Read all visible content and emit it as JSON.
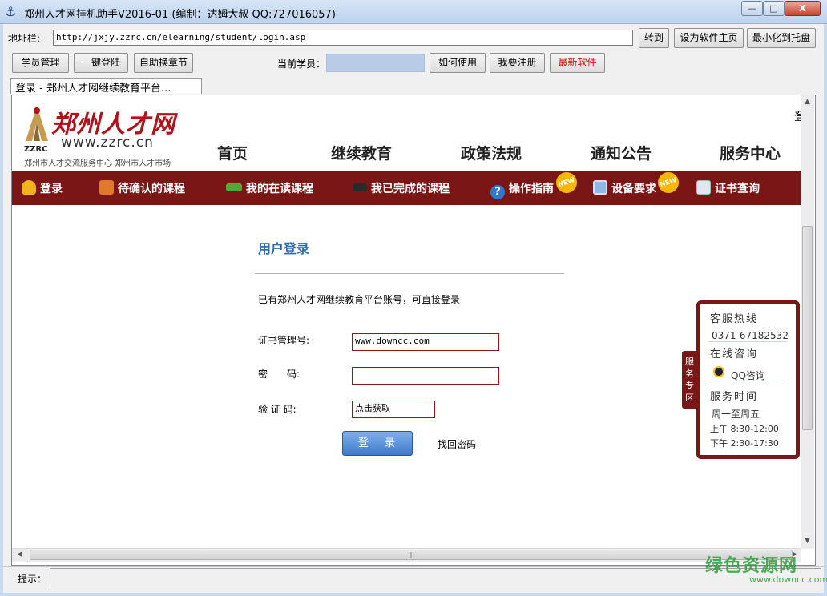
{
  "window": {
    "title": "郑州人才网挂机助手V2016-01 (编制：达姆大叔 QQ:727016057)",
    "min": "—",
    "max": "□",
    "close": "X"
  },
  "toolbar": {
    "address_label": "地址栏:",
    "address_value": "http://jxjy.zzrc.cn/elearning/student/login.asp",
    "go": "转到",
    "set_home": "设为软件主页",
    "to_tray": "最小化到托盘",
    "student_mgmt": "学员管理",
    "one_click_login": "一键登陆",
    "auto_chapter": "自助换章节",
    "current_student_label": "当前学员：",
    "current_student_value": "",
    "how_to_use": "如何使用",
    "register": "我要注册",
    "newest_software": "最新软件"
  },
  "tab": {
    "label": "登录 - 郑州人才网继续教育平台..."
  },
  "site": {
    "logo_cn": "郑州人才网",
    "logo_url": "www.zzrc.cn",
    "logo_abbr": "ZZRC",
    "logo_sub": "郑州市人才交流服务中心 郑州市人才市场",
    "edge_char": "登",
    "nav": [
      "首页",
      "继续教育",
      "政策法规",
      "通知公告",
      "服务中心"
    ],
    "subnav": [
      "登录",
      "待确认的课程",
      "我的在读课程",
      "我已完成的课程",
      "操作指南",
      "设备要求",
      "证书查询"
    ],
    "new_badge": "NEW"
  },
  "login": {
    "title": "用户登录",
    "desc": "已有郑州人才网继续教育平台账号，可直接登录",
    "cert_label": "证书管理号:",
    "cert_value": "www.downcc.com",
    "pwd_label": "密　　码:",
    "pwd_value": "",
    "captcha_label": "验 证 码:",
    "captcha_value": "点击获取",
    "submit": "登 录",
    "forgot": "找回密码"
  },
  "service": {
    "tab": "服务专区",
    "hotline_title": "客服热线",
    "hotline": "0371-67182532",
    "online_title": "在线咨询",
    "qq": "QQ咨询",
    "hours_title": "服务时间",
    "days": "周一至周五",
    "am": "上午 8:30-12:00",
    "pm": "下午 2:30-17:30"
  },
  "statusbar": {
    "label": "提示："
  },
  "watermark": {
    "text": "绿色资源网",
    "url": "www.downcc.com"
  },
  "colors": {
    "brand_red": "#7a1616",
    "link_blue": "#2c6eb4",
    "watermark_green": "#2e9e3a"
  }
}
